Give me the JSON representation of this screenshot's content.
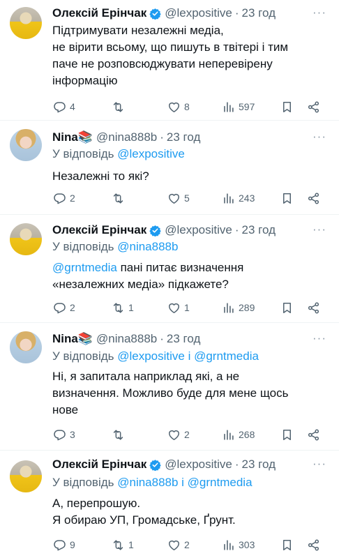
{
  "colors": {
    "text": "#0f1419",
    "muted": "#536471",
    "link": "#1d9bf0",
    "verified": "#1d9bf0",
    "divider": "#eff3f4"
  },
  "tweets": [
    {
      "name": "Олексій Ерінчак",
      "handle": "@lexpositive",
      "time": "23 год",
      "verified": true,
      "reply_prefix": "",
      "reply_to": "",
      "lines": [
        "Підтримувати незалежні медіа,",
        "не вірити всьому, що пишуть в твітері і тим",
        "паче не розповсюджувати неперевірену",
        "інформацію"
      ],
      "mention": "",
      "replies": "4",
      "retweets": "",
      "likes": "8",
      "views": "597"
    },
    {
      "name": "Nina📚",
      "handle": "@nina888b",
      "time": "23 год",
      "verified": false,
      "reply_prefix": "У відповідь",
      "reply_to": "@lexpositive",
      "lines": [
        "Незалежні то які?"
      ],
      "mention": "",
      "replies": "2",
      "retweets": "",
      "likes": "5",
      "views": "243"
    },
    {
      "name": "Олексій Ерінчак",
      "handle": "@lexpositive",
      "time": "23 год",
      "verified": true,
      "reply_prefix": "У відповідь",
      "reply_to": "@nina888b",
      "mention": "@grntmedia",
      "lines": [
        " пані питає визначення",
        "«незалежних медіа» підкажете?"
      ],
      "replies": "2",
      "retweets": "1",
      "likes": "1",
      "views": "289"
    },
    {
      "name": "Nina📚",
      "handle": "@nina888b",
      "time": "23 год",
      "verified": false,
      "reply_prefix": "У відповідь",
      "reply_to": "@lexpositive і @grntmedia",
      "lines": [
        "Ні, я запитала наприклад які, а не",
        "визначення. Можливо буде для мене щось",
        "нове"
      ],
      "mention": "",
      "replies": "3",
      "retweets": "",
      "likes": "2",
      "views": "268"
    },
    {
      "name": "Олексій Ерінчак",
      "handle": "@lexpositive",
      "time": "23 год",
      "verified": true,
      "reply_prefix": "У відповідь",
      "reply_to": "@nina888b і @grntmedia",
      "lines": [
        "А, перепрошую.",
        "Я обираю УП, Громадське, Ґрунт."
      ],
      "mention": "",
      "replies": "9",
      "retweets": "1",
      "likes": "2",
      "views": "303"
    }
  ],
  "icons": {
    "reply": "reply-icon",
    "retweet": "retweet-icon",
    "like": "heart-icon",
    "views": "views-icon",
    "bookmark": "bookmark-icon",
    "share": "share-icon",
    "more": "more-icon",
    "verified": "verified-badge-icon"
  },
  "more_glyph": "···",
  "separator": "·"
}
